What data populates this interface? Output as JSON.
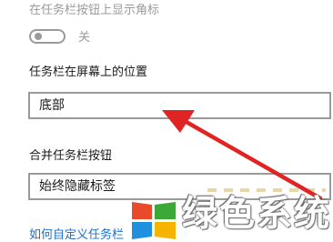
{
  "settings": {
    "badge_setting_label": "在任务栏按钮上显示角标",
    "badge_toggle_state": "关",
    "position_label": "任务栏在屏幕上的位置",
    "position_value": "底部",
    "combine_label": "合并任务栏按钮",
    "combine_value": "始终隐藏标签",
    "help_link": "如何自定义任务栏"
  },
  "watermark": {
    "text": "绿色系统"
  },
  "colors": {
    "arrow": "#e02424",
    "link": "#1d6fd0",
    "border": "#9a9a9a",
    "logo_red": "#e84a2b",
    "logo_green": "#3aa935",
    "logo_blue": "#1f8fe0",
    "logo_yellow": "#f4b400"
  }
}
